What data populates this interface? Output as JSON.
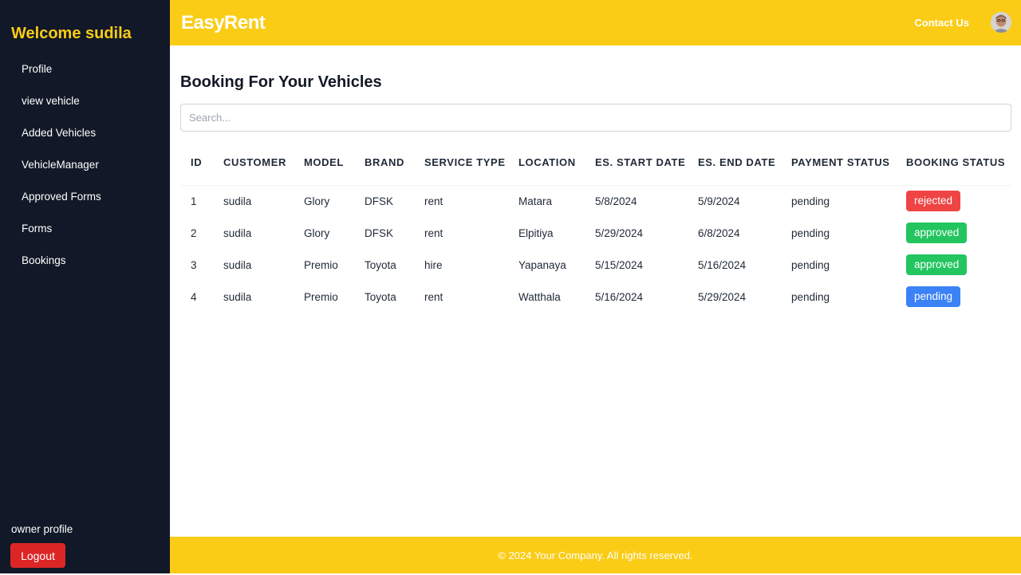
{
  "sidebar": {
    "welcome": "Welcome sudila",
    "items": [
      {
        "label": "Profile"
      },
      {
        "label": "view vehicle"
      },
      {
        "label": "Added Vehicles"
      },
      {
        "label": "VehicleManager"
      },
      {
        "label": "Approved Forms"
      },
      {
        "label": "Forms"
      },
      {
        "label": "Bookings"
      }
    ],
    "owner_profile": "owner profile",
    "logout_label": "Logout"
  },
  "header": {
    "brand": "EasyRent",
    "contact_label": "Contact Us",
    "avatar_icon": "user-avatar-icon"
  },
  "main": {
    "title": "Booking For Your Vehicles",
    "search": {
      "placeholder": "Search...",
      "value": ""
    },
    "table": {
      "columns": [
        {
          "key": "id",
          "label": "ID"
        },
        {
          "key": "customer",
          "label": "CUSTOMER"
        },
        {
          "key": "model",
          "label": "MODEL"
        },
        {
          "key": "brand",
          "label": "BRAND"
        },
        {
          "key": "service_type",
          "label": "SERVICE TYPE"
        },
        {
          "key": "location",
          "label": "LOCATION"
        },
        {
          "key": "start_date",
          "label": "ES. START DATE"
        },
        {
          "key": "end_date",
          "label": "ES. END DATE"
        },
        {
          "key": "payment_status",
          "label": "PAYMENT STATUS"
        },
        {
          "key": "booking_status",
          "label": "BOOKING STATUS"
        }
      ],
      "rows": [
        {
          "id": "1",
          "customer": "sudila",
          "model": "Glory",
          "brand": "DFSK",
          "service_type": "rent",
          "location": "Matara",
          "start_date": "5/8/2024",
          "end_date": "5/9/2024",
          "payment_status": "pending",
          "booking_status": "rejected"
        },
        {
          "id": "2",
          "customer": "sudila",
          "model": "Glory",
          "brand": "DFSK",
          "service_type": "rent",
          "location": "Elpitiya",
          "start_date": "5/29/2024",
          "end_date": "6/8/2024",
          "payment_status": "pending",
          "booking_status": "approved"
        },
        {
          "id": "3",
          "customer": "sudila",
          "model": "Premio",
          "brand": "Toyota",
          "service_type": "hire",
          "location": "Yapanaya",
          "start_date": "5/15/2024",
          "end_date": "5/16/2024",
          "payment_status": "pending",
          "booking_status": "approved"
        },
        {
          "id": "4",
          "customer": "sudila",
          "model": "Premio",
          "brand": "Toyota",
          "service_type": "rent",
          "location": "Watthala",
          "start_date": "5/16/2024",
          "end_date": "5/29/2024",
          "payment_status": "pending",
          "booking_status": "pending"
        }
      ]
    }
  },
  "status_colors": {
    "rejected": "#ef4444",
    "approved": "#22c55e",
    "pending": "#3b82f6"
  },
  "colors": {
    "accent": "#facc15",
    "sidebar_bg": "#111827",
    "logout": "#dc2626"
  },
  "footer": {
    "text": "© 2024 Your Company. All rights reserved."
  }
}
